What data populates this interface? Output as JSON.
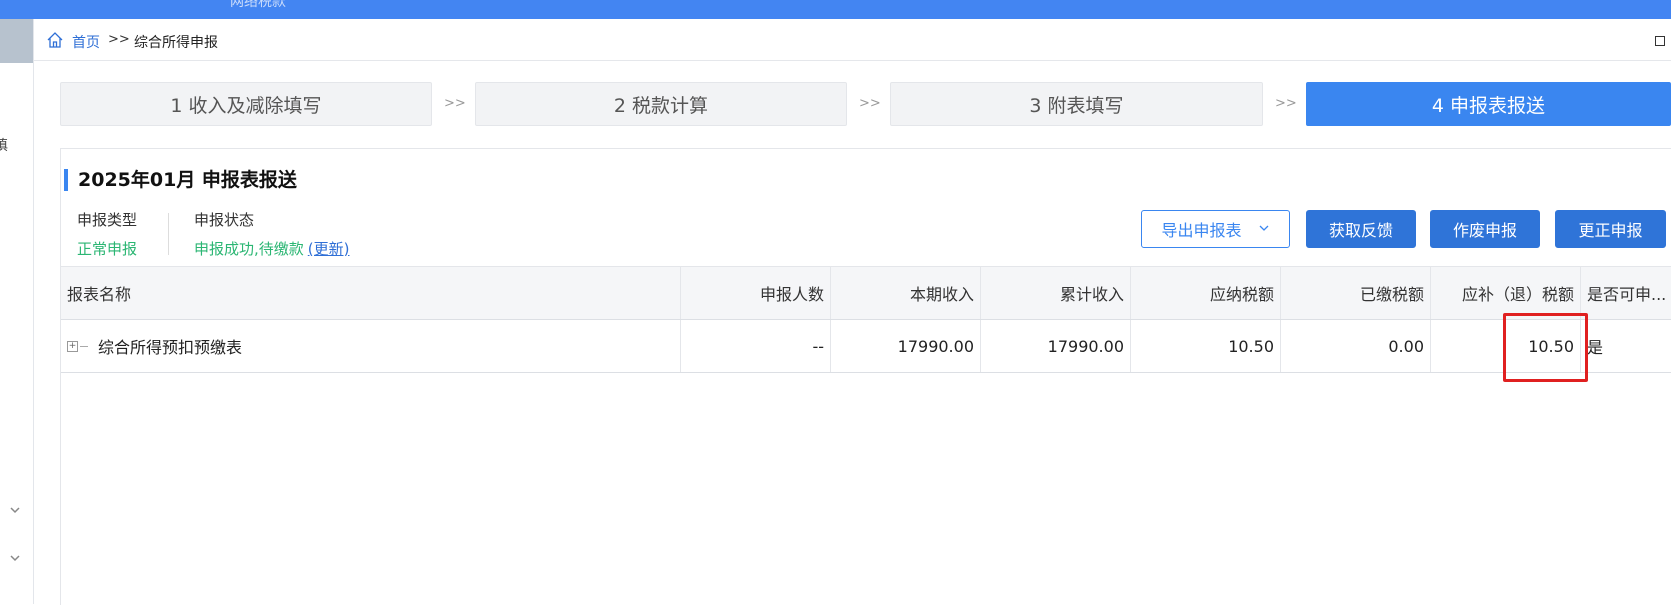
{
  "topbar": {
    "partial_text": "网络税款"
  },
  "breadcrumb": {
    "home": "首页",
    "separator": ">>",
    "current": "综合所得申报"
  },
  "steps": [
    {
      "label": "1 收入及减除填写",
      "active": false
    },
    {
      "label": "2 税款计算",
      "active": false
    },
    {
      "label": "3 附表填写",
      "active": false
    },
    {
      "label": "4 申报表报送",
      "active": true
    }
  ],
  "step_arrow": ">>",
  "panel": {
    "title": "2025年01月  申报表报送",
    "type_label": "申报类型",
    "type_value": "正常申报",
    "status_label": "申报状态",
    "status_value": "申报成功,待缴款",
    "status_refresh": "(更新)"
  },
  "buttons": {
    "export": "导出申报表",
    "feedback": "获取反馈",
    "void": "作废申报",
    "correct": "更正申报"
  },
  "table": {
    "headers": [
      "报表名称",
      "申报人数",
      "本期收入",
      "累计收入",
      "应纳税额",
      "已缴税额",
      "应补（退）税额",
      "是否可申..."
    ],
    "rows": [
      {
        "name": "综合所得预扣预缴表",
        "people": "--",
        "current_income": "17990.00",
        "cumulative_income": "17990.00",
        "tax_payable": "10.50",
        "tax_paid": "0.00",
        "tax_due": "10.50",
        "can_declare": "是"
      }
    ]
  },
  "colors": {
    "accent": "#3a86f0",
    "success": "#2bb673",
    "highlight": "#e02020"
  }
}
